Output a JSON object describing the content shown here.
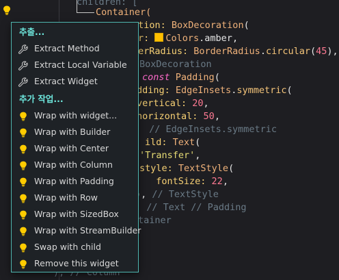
{
  "editor": {
    "lines": [
      {
        "segments": [
          {
            "t": "children: [",
            "c": "cmt"
          }
        ]
      },
      {
        "segments": [
          {
            "t": "Container(",
            "c": "cls"
          }
        ]
      },
      {
        "segments": [
          {
            "t": "ation: ",
            "c": "prop"
          },
          {
            "t": "BoxDecoration",
            "c": "cls"
          },
          {
            "t": "(",
            "c": "punc"
          }
        ]
      },
      {
        "segments": [
          {
            "t": "r: ",
            "c": "prop"
          },
          {
            "t": "SWATCH",
            "c": "swatch"
          },
          {
            "t": "Colors",
            "c": "cls"
          },
          {
            "t": ".amber,",
            "c": "punc"
          }
        ]
      },
      {
        "segments": [
          {
            "t": "erRadius: ",
            "c": "prop"
          },
          {
            "t": "BorderRadius",
            "c": "cls"
          },
          {
            "t": ".",
            "c": "punc"
          },
          {
            "t": "circular",
            "c": "fn"
          },
          {
            "t": "(",
            "c": "punc"
          },
          {
            "t": "45",
            "c": "num2"
          },
          {
            "t": "),",
            "c": "punc"
          }
        ]
      },
      {
        "segments": [
          {
            "t": "BoxDecoration",
            "c": "cmt"
          }
        ]
      },
      {
        "segments": [
          {
            "t": "const ",
            "c": "kw"
          },
          {
            "t": "Padding",
            "c": "cls"
          },
          {
            "t": "(",
            "c": "punc"
          }
        ]
      },
      {
        "segments": [
          {
            "t": "dding: ",
            "c": "prop"
          },
          {
            "t": "EdgeInsets",
            "c": "cls"
          },
          {
            "t": ".",
            "c": "punc"
          },
          {
            "t": "symmetric",
            "c": "fn"
          },
          {
            "t": "(",
            "c": "punc"
          }
        ]
      },
      {
        "segments": [
          {
            "t": "vertical: ",
            "c": "prop"
          },
          {
            "t": "20",
            "c": "num2"
          },
          {
            "t": ",",
            "c": "punc"
          }
        ]
      },
      {
        "segments": [
          {
            "t": "horizontal: ",
            "c": "prop"
          },
          {
            "t": "50",
            "c": "num2"
          },
          {
            "t": ",",
            "c": "punc"
          }
        ]
      },
      {
        "segments": [
          {
            "t": " // EdgeInsets.symmetric",
            "c": "cmt"
          }
        ]
      },
      {
        "segments": [
          {
            "t": "ild: ",
            "c": "prop"
          },
          {
            "t": "Text",
            "c": "cls"
          },
          {
            "t": "(",
            "c": "punc"
          }
        ]
      },
      {
        "segments": [
          {
            "t": "'Transfer'",
            "c": "str"
          },
          {
            "t": ",",
            "c": "punc"
          }
        ]
      },
      {
        "segments": [
          {
            "t": "style: ",
            "c": "prop"
          },
          {
            "t": "TextStyle",
            "c": "cls"
          },
          {
            "t": "(",
            "c": "punc"
          }
        ]
      },
      {
        "segments": [
          {
            "t": "  fontSize: ",
            "c": "prop"
          },
          {
            "t": "22",
            "c": "num2"
          },
          {
            "t": ",",
            "c": "punc"
          }
        ]
      },
      {
        "segments": [
          {
            "t": "), ",
            "c": "punc"
          },
          {
            "t": "// TextStyle",
            "c": "cmt"
          }
        ]
      },
      {
        "segments": [
          {
            "t": ", ",
            "c": "punc"
          },
          {
            "t": "// Text // Padding",
            "c": "cmt"
          }
        ]
      },
      {
        "segments": [
          {
            "t": "tainer",
            "c": "cmt"
          }
        ]
      },
      {
        "segments": [
          {
            "t": "",
            "c": "cmt"
          }
        ]
      },
      {
        "segments": [
          {
            "t": "), // Column",
            "c": "cmt"
          }
        ]
      }
    ]
  },
  "menu": {
    "section1_title": "추출...",
    "section1_items": [
      {
        "label": "Extract Method",
        "icon": "wrench-icon"
      },
      {
        "label": "Extract Local Variable",
        "icon": "wrench-icon"
      },
      {
        "label": "Extract Widget",
        "icon": "wrench-icon"
      }
    ],
    "section2_title": "추가 작업...",
    "section2_items": [
      {
        "label": "Wrap with widget...",
        "icon": "lightbulb-icon"
      },
      {
        "label": "Wrap with Builder",
        "icon": "lightbulb-icon"
      },
      {
        "label": "Wrap with Center",
        "icon": "lightbulb-icon"
      },
      {
        "label": "Wrap with Column",
        "icon": "lightbulb-icon"
      },
      {
        "label": "Wrap with Padding",
        "icon": "lightbulb-icon"
      },
      {
        "label": "Wrap with Row",
        "icon": "lightbulb-icon"
      },
      {
        "label": "Wrap with SizedBox",
        "icon": "lightbulb-icon"
      },
      {
        "label": "Wrap with StreamBuilder",
        "icon": "lightbulb-icon"
      },
      {
        "label": "Swap with child",
        "icon": "lightbulb-icon"
      },
      {
        "label": "Remove this widget",
        "icon": "lightbulb-icon"
      }
    ]
  },
  "colors": {
    "accent": "#6ee7dd",
    "menu_border": "#4fb7b0",
    "bulb": "#ffcc00",
    "amber_swatch": "#ffbf00"
  }
}
